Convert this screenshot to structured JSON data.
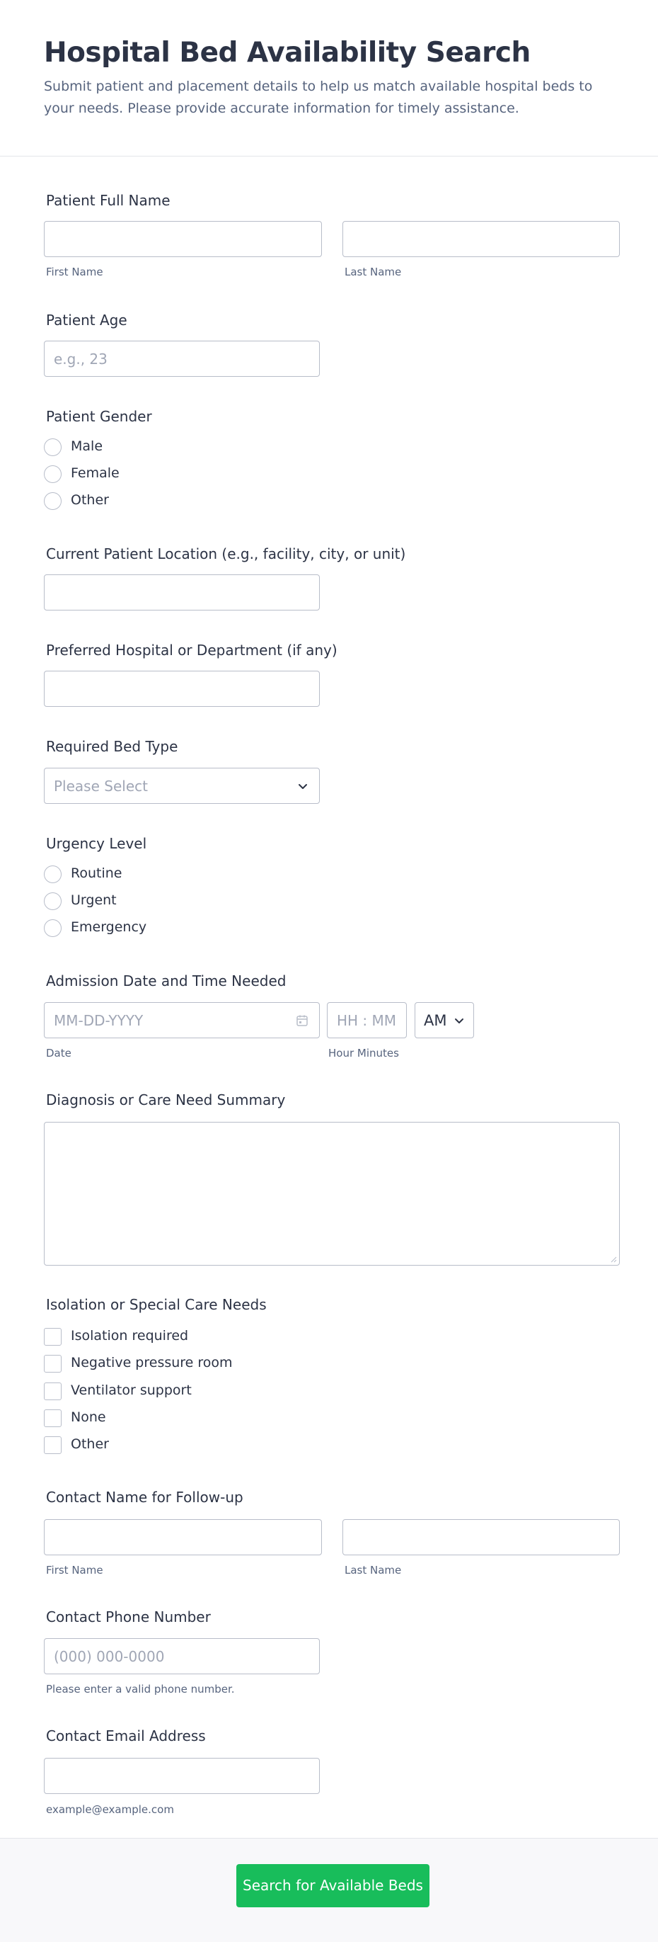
{
  "header": {
    "title": "Hospital Bed Availability Search",
    "subtitle": "Submit patient and placement details to help us match available hospital beds to your needs. Please provide accurate information for timely assistance."
  },
  "patient_name": {
    "label": "Patient Full Name",
    "first_sub": "First Name",
    "last_sub": "Last Name",
    "first_value": "",
    "last_value": ""
  },
  "patient_age": {
    "label": "Patient Age",
    "placeholder": "e.g., 23"
  },
  "patient_gender": {
    "label": "Patient Gender",
    "options": [
      "Male",
      "Female",
      "Other"
    ]
  },
  "current_location": {
    "label": "Current Patient Location (e.g., facility, city, or unit)",
    "value": ""
  },
  "preferred_hospital": {
    "label": "Preferred Hospital or Department (if any)",
    "value": ""
  },
  "bed_type": {
    "label": "Required Bed Type",
    "placeholder": "Please Select",
    "icon": "chevron-down-icon"
  },
  "urgency": {
    "label": "Urgency Level",
    "options": [
      "Routine",
      "Urgent",
      "Emergency"
    ]
  },
  "admission": {
    "label": "Admission Date and Time Needed",
    "date_placeholder": "MM-DD-YYYY",
    "time_placeholder": "HH : MM",
    "ampm": "AM",
    "date_sub": "Date",
    "time_sub": "Hour Minutes",
    "icon": "calendar-icon"
  },
  "diagnosis": {
    "label": "Diagnosis or Care Need Summary",
    "value": ""
  },
  "isolation": {
    "label": "Isolation or Special Care Needs",
    "options": [
      "Isolation required",
      "Negative pressure room",
      "Ventilator support",
      "None",
      "Other"
    ]
  },
  "contact_name": {
    "label": "Contact Name for Follow-up",
    "first_sub": "First Name",
    "last_sub": "Last Name"
  },
  "contact_phone": {
    "label": "Contact Phone Number",
    "placeholder": "(000) 000-0000",
    "sub": "Please enter a valid phone number."
  },
  "contact_email": {
    "label": "Contact Email Address",
    "sub": "example@example.com"
  },
  "submit": {
    "label": "Search for Available Beds"
  },
  "colors": {
    "accent": "#18bd5b",
    "text": "#2c3345",
    "muted": "#57647e",
    "border": "#b8bdc9"
  }
}
